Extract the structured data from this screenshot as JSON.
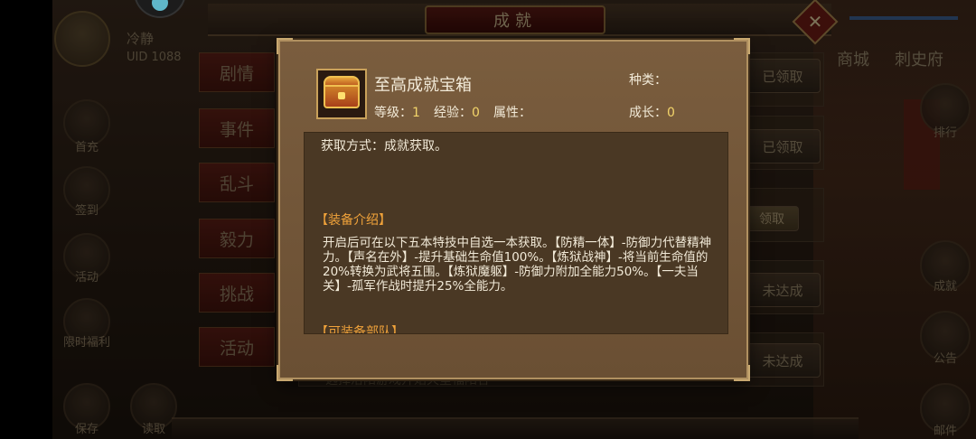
{
  "colors": {
    "accent_orange": "#f0a23a",
    "value_yellow": "#f2d46a",
    "popup_bg": "#6a4f33",
    "text_light": "#f2ead8"
  },
  "player": {
    "name": "冷静",
    "uid": "UID  1088"
  },
  "panel": {
    "title": "成就"
  },
  "top_nav": {
    "item1": "商城",
    "item2": "刺史府"
  },
  "tabs": [
    "剧情",
    "事件",
    "乱斗",
    "毅力",
    "挑战",
    "活动"
  ],
  "left_icons": [
    "首充",
    "签到",
    "活动",
    "限时福利",
    "保存",
    "读取"
  ],
  "right_icons": [
    "排行",
    "成就",
    "公告",
    "邮件"
  ],
  "rows": [
    {
      "status": "已领取"
    },
    {
      "status": "已领取"
    },
    {
      "status": "领取"
    },
    {
      "status": "未达成"
    },
    {
      "status": "未达成"
    }
  ],
  "row_footer": "选择洛阳游戏开始天堂福阳各",
  "popup": {
    "item_name": "至高成就宝箱",
    "type_label": "种类：",
    "level_label": "等级：",
    "level_value": "1",
    "exp_label": "经验：",
    "exp_value": "0",
    "attr_label": "属性：",
    "growth_label": "成长：",
    "growth_value": "0",
    "acquire": "获取方式：成就获取。",
    "section1_title": "【装备介绍】",
    "section1_body": "开启后可在以下五本特技中自选一本获取。【防精一体】-防御力代替精神力。【声名在外】-提升基础生命值100%。【炼狱战神】-将当前生命值的20%转换为武将五围。【炼狱魔躯】-防御力附加全能力50%。【一夫当关】-孤军作战时提升25%全能力。",
    "section2_title": "【可装备部队】"
  }
}
